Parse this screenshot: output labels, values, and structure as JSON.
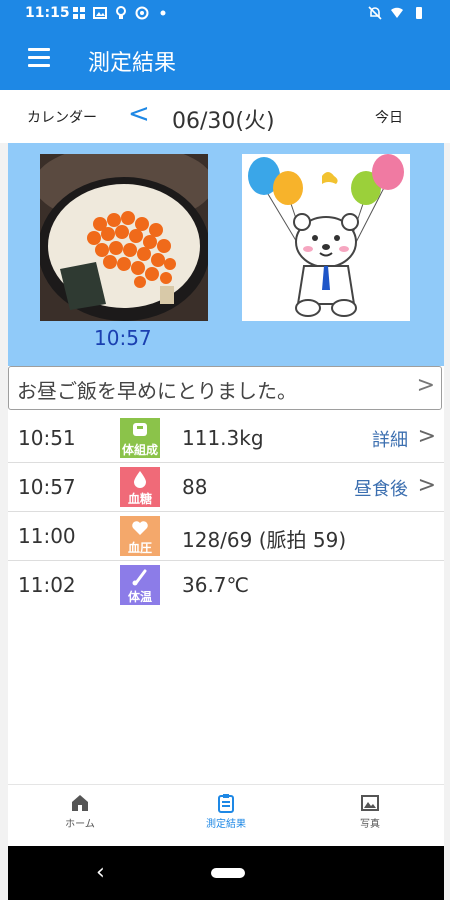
{
  "status_bar": {
    "time": "11:15",
    "left_icons": [
      "grid-icon",
      "image-icon",
      "bulb-icon",
      "circle-icon",
      "dot-icon"
    ],
    "right_icons": [
      "bell-off-icon",
      "wifi-icon",
      "battery-icon"
    ]
  },
  "app_bar": {
    "title": "測定結果",
    "menu_icon": "hamburger-menu-icon"
  },
  "date_bar": {
    "calendar_label": "カレンダー",
    "prev_label": "<",
    "date": "06/30(火)",
    "today_label": "今日"
  },
  "photos": {
    "meal_photo_time": "10:57"
  },
  "memo": {
    "text": "お昼ご飯を早めにとりました。",
    "chevron": ">"
  },
  "measurements": [
    {
      "time": "10:51",
      "badge": "体組成",
      "value": "111.3kg",
      "link": "詳細",
      "chevron": ">",
      "color": "#8bc34a"
    },
    {
      "time": "10:57",
      "badge": "血糖",
      "value": "88",
      "link": "昼食後",
      "chevron": ">",
      "color": "#f06a78"
    },
    {
      "time": "11:00",
      "badge": "血圧",
      "value": "128/69 (脈拍 59)",
      "link": "",
      "chevron": "",
      "color": "#f4a86b"
    },
    {
      "time": "11:02",
      "badge": "体温",
      "value": "36.7℃",
      "link": "",
      "chevron": "",
      "color": "#8c7ce8"
    }
  ],
  "bottom_nav": {
    "home": "ホーム",
    "results": "測定結果",
    "photos": "写真"
  },
  "system_nav": {
    "back": "‹"
  },
  "colors": {
    "primary": "#1e88e5",
    "photo_bg": "#90caf9",
    "link": "#3c6fb0"
  }
}
